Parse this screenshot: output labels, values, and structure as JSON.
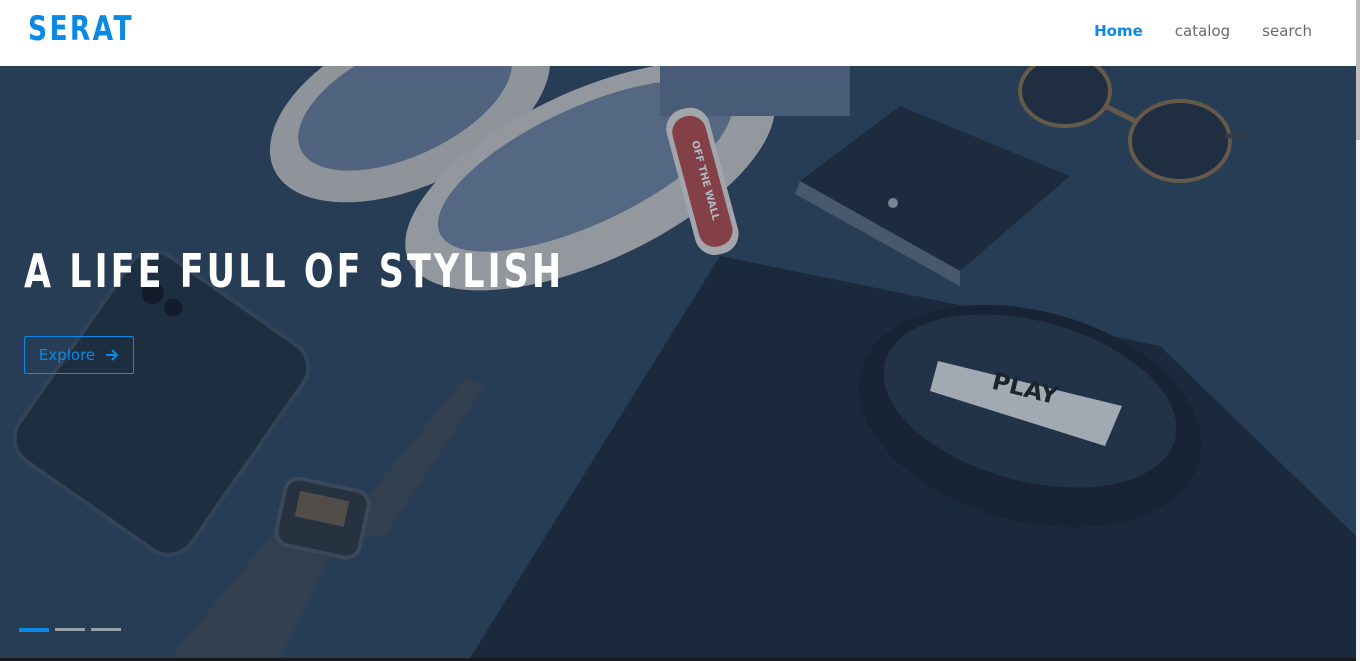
{
  "brand": {
    "logo": "SERAT"
  },
  "nav": {
    "items": [
      "Home",
      "catalog",
      "search"
    ],
    "active": "Home"
  },
  "hero": {
    "title": "A LIFE FULL OF STYLISH",
    "button_label": "Explore",
    "button_icon": "arrow-right-icon",
    "slides": {
      "count": 3,
      "active_index": 0
    },
    "image_tag_text": "OFF THE WALL",
    "image_label_text": "PLAY"
  },
  "colors": {
    "accent": "#0a8ae6",
    "nav_text": "#6a6a6a",
    "hero_bg": "#2a3d55"
  }
}
